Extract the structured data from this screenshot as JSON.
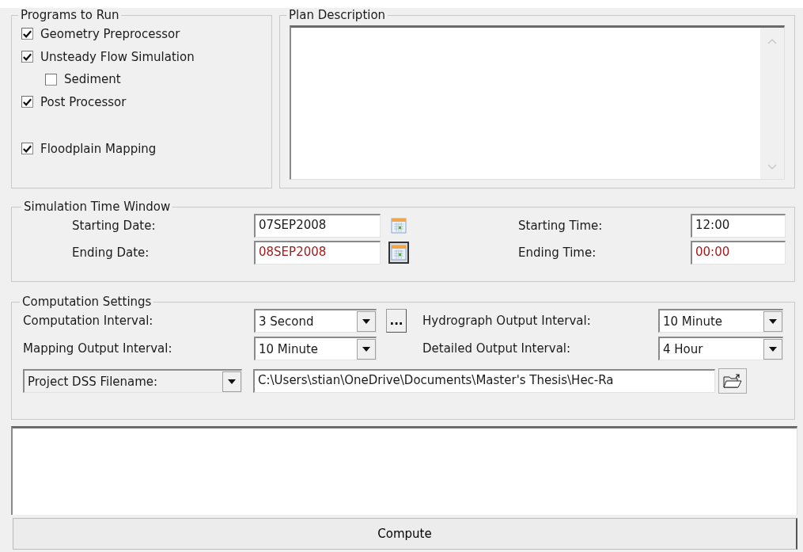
{
  "programs": {
    "title": "Programs to Run",
    "items": [
      {
        "label": "Geometry Preprocessor",
        "checked": true
      },
      {
        "label": "Unsteady Flow Simulation",
        "checked": true,
        "children": [
          {
            "label": "Sediment",
            "checked": false
          }
        ]
      },
      {
        "label": "Post Processor",
        "checked": true
      },
      {
        "label": "Floodplain Mapping",
        "checked": true
      }
    ]
  },
  "plan_description": {
    "title": "Plan Description"
  },
  "simulation_time_window": {
    "title": "Simulation Time Window",
    "rows": [
      {
        "date_label": "Starting Date:",
        "date": "07SEP2008",
        "date_modified": false,
        "calendar_pressed": false,
        "time_label": "Starting Time:",
        "time": "12:00",
        "time_modified": false
      },
      {
        "date_label": "Ending Date:",
        "date": "08SEP2008",
        "date_modified": true,
        "calendar_pressed": true,
        "time_label": "Ending Time:",
        "time": "00:00",
        "time_modified": true
      }
    ]
  },
  "computation_settings": {
    "title": "Computation Settings",
    "rows": [
      {
        "label": "Computation Interval:",
        "value": "3 Second",
        "more_label": "...",
        "right_label": "Hydrograph Output Interval:",
        "right_value": "10 Minute"
      },
      {
        "label": "Mapping Output Interval:",
        "value": "10 Minute",
        "right_label": "Detailed Output Interval:",
        "right_value": "4 Hour"
      }
    ],
    "dss_selector": "Project DSS Filename:",
    "dss_path": "C:\\Users\\stian\\OneDrive\\Documents\\Master's Thesis\\Hec-Ra"
  },
  "compute_button": "Compute"
}
